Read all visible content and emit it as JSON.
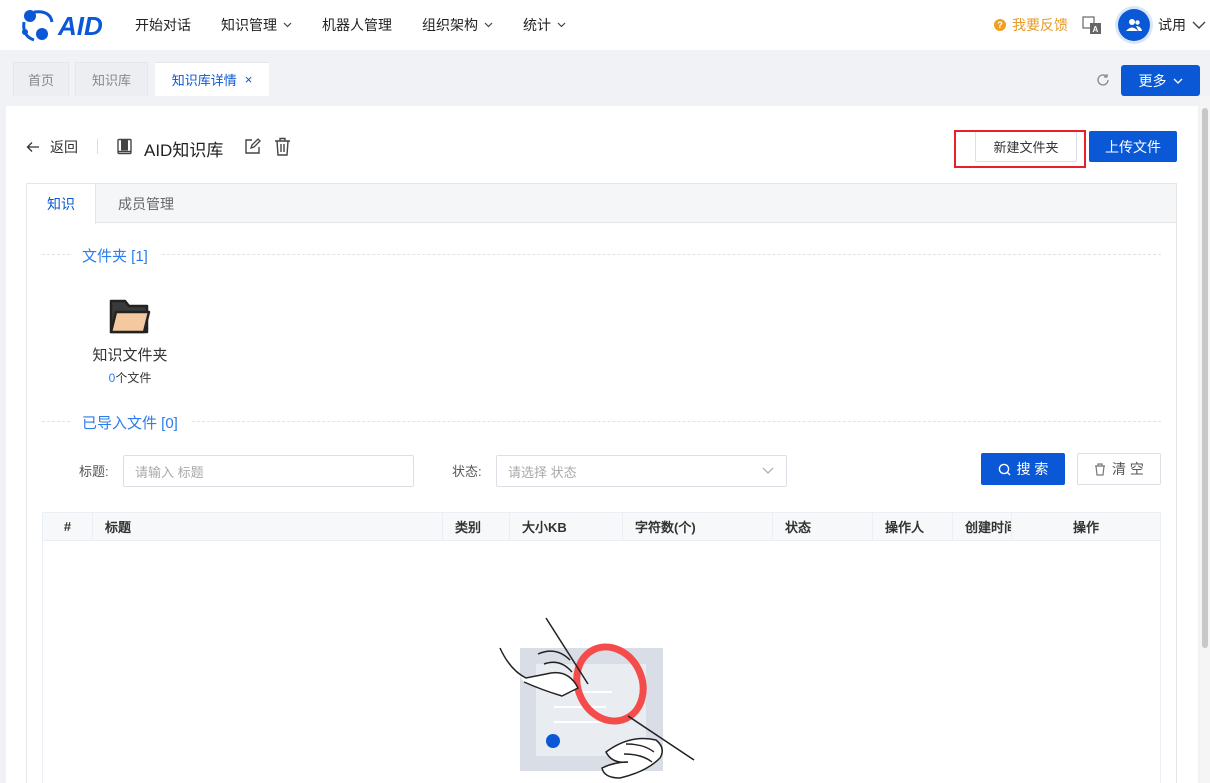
{
  "app": {
    "logo_text": "AID"
  },
  "nav": {
    "items": [
      {
        "label": "开始对话",
        "has_dropdown": false
      },
      {
        "label": "知识管理",
        "has_dropdown": true
      },
      {
        "label": "机器人管理",
        "has_dropdown": false
      },
      {
        "label": "组织架构",
        "has_dropdown": true
      },
      {
        "label": "统计",
        "has_dropdown": true
      }
    ]
  },
  "header_right": {
    "feedback_label": "我要反馈",
    "username": "试用"
  },
  "tabs": {
    "items": [
      {
        "label": "首页",
        "active": false
      },
      {
        "label": "知识库",
        "active": false
      },
      {
        "label": "知识库详情",
        "active": true
      }
    ],
    "close_glyph": "×",
    "more_label": "更多"
  },
  "page": {
    "back_label": "返回",
    "kb_title": "AID知识库",
    "new_folder_label": "新建文件夹",
    "upload_label": "上传文件"
  },
  "card_tabs": {
    "items": [
      {
        "label": "知识",
        "active": true
      },
      {
        "label": "成员管理",
        "active": false
      }
    ]
  },
  "folders_section": {
    "title": "文件夹 [1]",
    "folders": [
      {
        "name": "知识文件夹",
        "count": "0",
        "count_suffix": "个文件"
      }
    ]
  },
  "imported_section": {
    "title": "已导入文件 [0]"
  },
  "filters": {
    "title_label": "标题:",
    "title_placeholder": "请输入 标题",
    "status_label": "状态:",
    "status_placeholder": "请选择 状态",
    "search_label": "搜 索",
    "clear_label": "清 空"
  },
  "table": {
    "columns": [
      "#",
      "标题",
      "类别",
      "大小KB",
      "字符数(个)",
      "状态",
      "操作人",
      "创建时间",
      "操作"
    ],
    "rows": []
  },
  "colors": {
    "primary": "#0a58d6",
    "link": "#2b7de9",
    "feedback": "#e89b2b",
    "highlight": "#e8202a"
  }
}
